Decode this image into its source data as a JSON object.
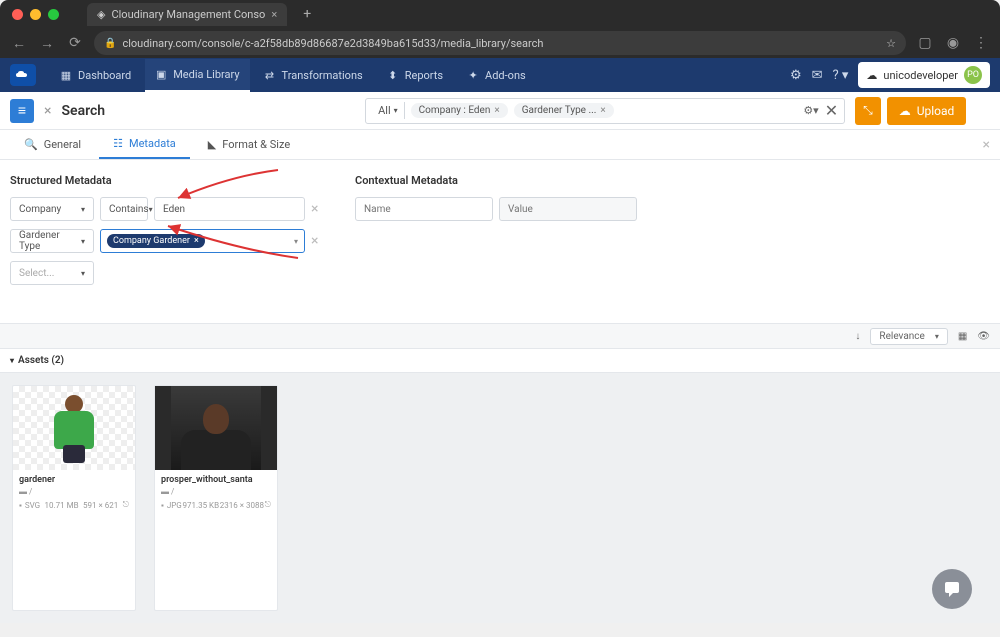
{
  "browser": {
    "tab_title": "Cloudinary Management Conso",
    "url": "cloudinary.com/console/c-a2f58db89d86687e2d3849ba615d33/media_library/search"
  },
  "header": {
    "nav": [
      "Dashboard",
      "Media Library",
      "Transformations",
      "Reports",
      "Add-ons"
    ],
    "active_nav_index": 1,
    "username": "unicodeveloper",
    "user_initials": "PO"
  },
  "search": {
    "title": "Search",
    "scope": "All",
    "chips": [
      "Company : Eden",
      "Gardener Type ..."
    ],
    "upload_label": "Upload"
  },
  "subtabs": {
    "items": [
      "General",
      "Metadata",
      "Format & Size"
    ],
    "active_index": 1
  },
  "structured_metadata": {
    "title": "Structured Metadata",
    "rows": [
      {
        "field": "Company",
        "op": "Contains",
        "value": "Eden"
      },
      {
        "field": "Gardener Type",
        "tags": [
          "Company Gardener"
        ]
      }
    ],
    "select_placeholder": "Select..."
  },
  "contextual_metadata": {
    "title": "Contextual Metadata",
    "name_placeholder": "Name",
    "value_placeholder": "Value"
  },
  "results": {
    "sort_label": "Relevance",
    "assets_label": "Assets (2)",
    "assets": [
      {
        "name": "gardener",
        "folder": "/",
        "format": "SVG",
        "size": "10.71 MB",
        "dims": "591 × 621"
      },
      {
        "name": "prosper_without_santa",
        "folder": "/",
        "format": "JPG",
        "size": "971.35 KB",
        "dims": "2316 × 3088"
      }
    ]
  }
}
